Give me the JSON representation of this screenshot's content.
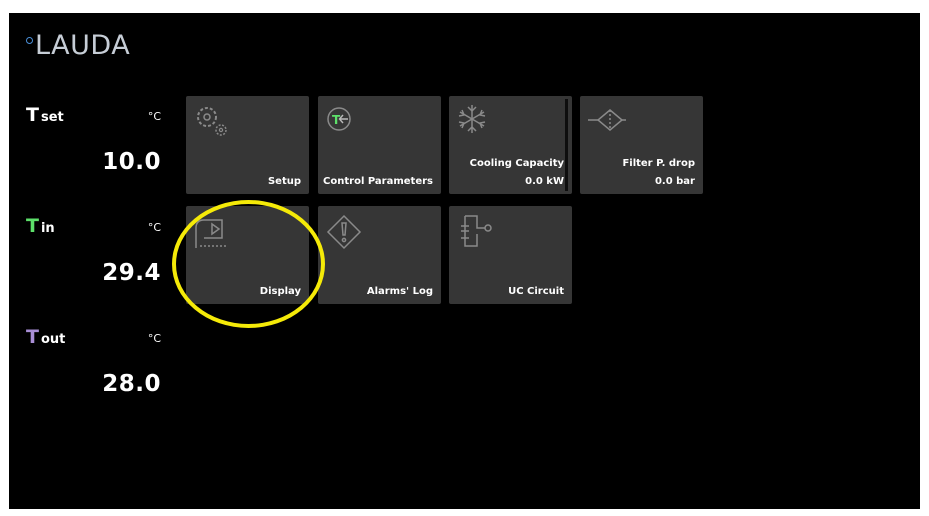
{
  "logo": {
    "text": "LAUDA"
  },
  "temperatures": {
    "tset": {
      "label_main": "T",
      "label_sub": "set",
      "unit": "°C",
      "value": "10.0"
    },
    "tin": {
      "label_main": "T",
      "label_sub": "in",
      "unit": "°C",
      "value": "29.4"
    },
    "tout": {
      "label_main": "T",
      "label_sub": "out",
      "unit": "°C",
      "value": "28.0"
    }
  },
  "tiles": {
    "setup": {
      "label": "Setup",
      "icon": "gears-icon"
    },
    "control_parameters": {
      "label": "Control Parameters",
      "icon": "t-arrow-icon",
      "icon_text": "T"
    },
    "cooling_capacity": {
      "label": "Cooling Capacity",
      "value": "0.0 kW",
      "icon": "snowflake-icon"
    },
    "filter_pressure_drop": {
      "label": "Filter P. drop",
      "value": "0.0 bar",
      "icon": "filter-icon"
    },
    "display": {
      "label": "Display",
      "icon": "display-icon"
    },
    "alarms_log": {
      "label": "Alarms' Log",
      "icon": "warning-diamond-icon"
    },
    "uc_circuit": {
      "label": "UC Circuit",
      "icon": "circuit-icon"
    }
  },
  "colors": {
    "background": "#000000",
    "tile": "#363636",
    "tin_accent": "#5de06a",
    "tout_accent": "#a98ed6",
    "highlight": "#f5ea08",
    "logo_mark": "#4a8fd8"
  }
}
